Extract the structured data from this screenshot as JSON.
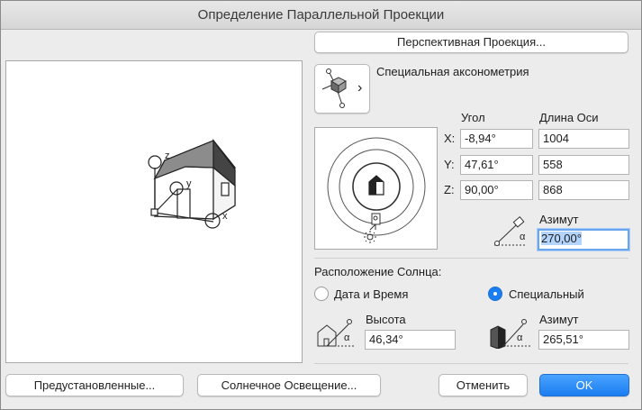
{
  "window": {
    "title": "Определение Параллельной Проекции"
  },
  "perspective_button": "Перспективная Проекция...",
  "axonometry": {
    "label": "Специальная аксонометрия",
    "chevron": "›"
  },
  "axes_table": {
    "angle_header": "Угол",
    "axis_length_header": "Длина Оси",
    "rows": [
      {
        "label": "X:",
        "angle": "-8,94°",
        "length": "1004"
      },
      {
        "label": "Y:",
        "angle": "47,61°",
        "length": "558"
      },
      {
        "label": "Z:",
        "angle": "90,00°",
        "length": "868"
      }
    ]
  },
  "view_azimuth": {
    "label": "Азимут",
    "value": "270,00°",
    "alpha": "α"
  },
  "preview_axes": {
    "z": "z",
    "y": "y",
    "x": "x"
  },
  "sun": {
    "section_label": "Расположение Солнца:",
    "option_datetime": "Дата и Время",
    "option_custom": "Специальный",
    "selected": "custom",
    "altitude_label": "Высота",
    "altitude_value": "46,34°",
    "azimuth_label": "Азимут",
    "azimuth_value": "265,51°",
    "alpha": "α"
  },
  "footer": {
    "presets": "Предустановленные...",
    "sun_lighting": "Солнечное Освещение...",
    "cancel": "Отменить",
    "ok": "OK"
  }
}
